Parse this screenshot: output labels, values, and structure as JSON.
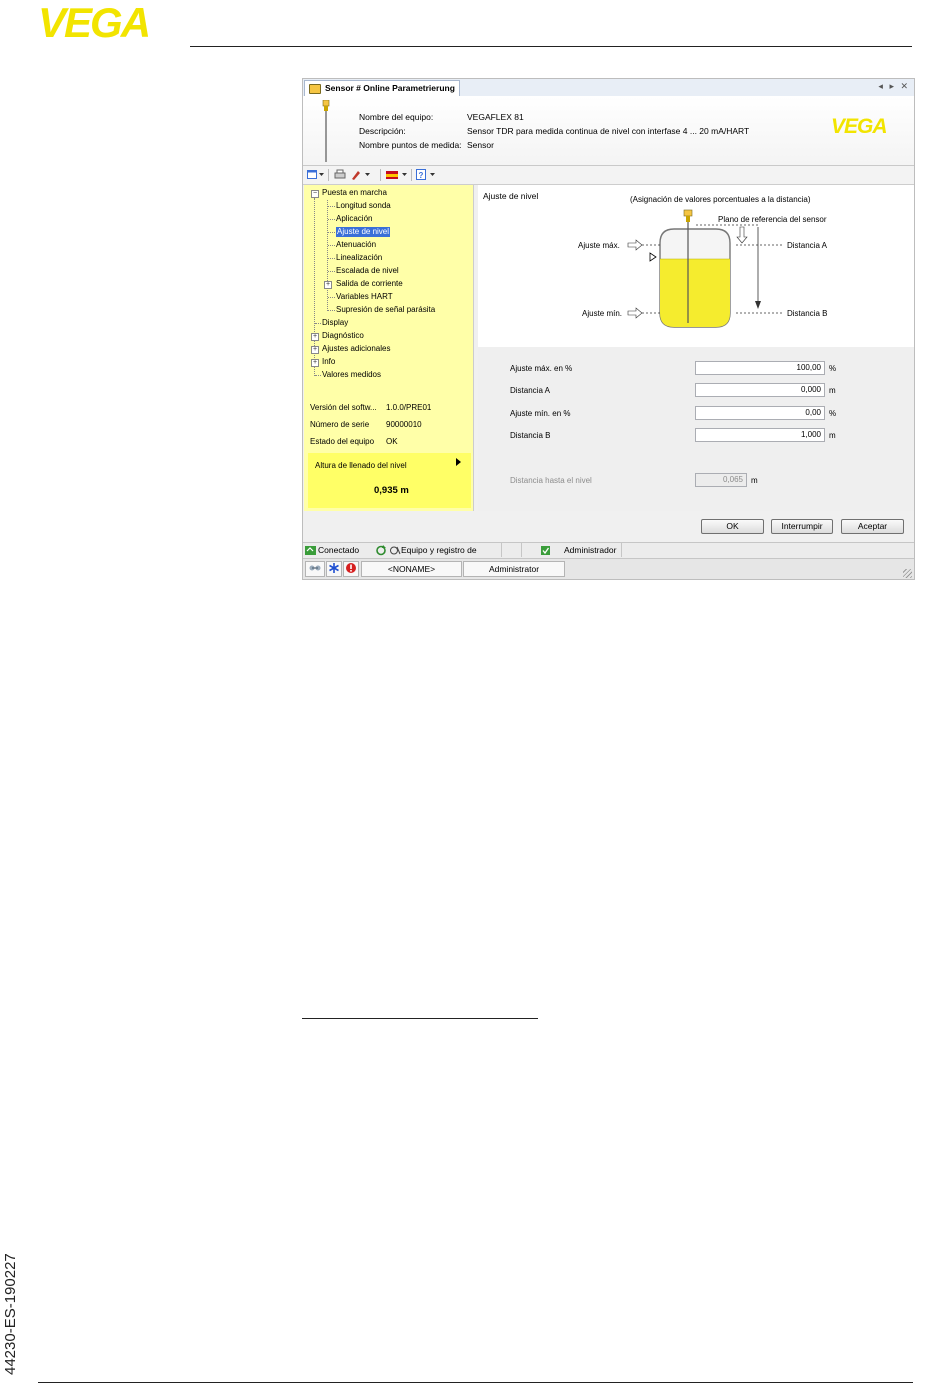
{
  "brand": {
    "logo_text": "VEGA",
    "color": "#F2E400"
  },
  "doc_number": "44230-ES-190227",
  "window": {
    "tab_title": "Sensor # Online Parametrierung",
    "tab_controls": "◂ ▸ ✕",
    "device": {
      "labels": [
        "Nombre del equipo:",
        "Descripción:",
        "Nombre puntos de medida:"
      ],
      "values": [
        "VEGAFLEX 81",
        "Sensor TDR para medida continua de nivel con interfase 4 ... 20 mA/HART",
        "Sensor"
      ],
      "logo_text": "VEGA"
    },
    "tree": [
      {
        "label": "Puesta en marcha",
        "level": 0,
        "expander": "−"
      },
      {
        "label": "Longitud sonda",
        "level": 1
      },
      {
        "label": "Aplicación",
        "level": 1
      },
      {
        "label": "Ajuste de nivel",
        "level": 1,
        "selected": true
      },
      {
        "label": "Atenuación",
        "level": 1
      },
      {
        "label": "Linealización",
        "level": 1
      },
      {
        "label": "Escalada de nivel",
        "level": 1
      },
      {
        "label": "Salida de corriente",
        "level": 1,
        "expander": "+"
      },
      {
        "label": "Variables HART",
        "level": 1
      },
      {
        "label": "Supresión de señal parásita",
        "level": 1
      },
      {
        "label": "Display",
        "level": 0
      },
      {
        "label": "Diagnóstico",
        "level": 0,
        "expander": "+"
      },
      {
        "label": "Ajustes adicionales",
        "level": 0,
        "expander": "+"
      },
      {
        "label": "Info",
        "level": 0,
        "expander": "+"
      },
      {
        "label": "Valores medidos",
        "level": 0
      }
    ],
    "info": {
      "software_label": "Versión del softw...",
      "software_value": "1.0.0/PRE01",
      "serial_label": "Número de serie",
      "serial_value": "90000010",
      "state_label": "Estado del equipo",
      "state_value": "OK"
    },
    "fill_panel": {
      "label": "Altura de llenado del nivel",
      "value": "0,935 m"
    },
    "diagram": {
      "title": "Ajuste de nivel",
      "subtitle": "(Asignación de valores porcentuales a la distancia)",
      "ref_plane": "Plano de referencia del sensor",
      "max_label": "Ajuste máx.",
      "min_label": "Ajuste mín.",
      "dist_a": "Distancia A",
      "dist_b": "Distancia B",
      "fill_color": "#F5EC2E"
    },
    "form": {
      "rows": [
        {
          "label": "Ajuste máx. en %",
          "value": "100,00",
          "unit": "%"
        },
        {
          "label": "Distancia A",
          "value": "0,000",
          "unit": "m"
        },
        {
          "label": "Ajuste mín. en %",
          "value": "0,00",
          "unit": "%"
        },
        {
          "label": "Distancia B",
          "value": "1,000",
          "unit": "m"
        }
      ],
      "level_distance": {
        "label": "Distancia hasta el nivel",
        "value": "0,065",
        "unit": "m"
      }
    },
    "buttons": {
      "ok": "OK",
      "cancel": "Interrumpir",
      "accept": "Aceptar"
    },
    "status": {
      "connected": "Conectado",
      "equipment": "Equipo y registro de",
      "role": "Administrador"
    },
    "bottom": {
      "project": "<NONAME>",
      "user": "Administrator"
    }
  }
}
